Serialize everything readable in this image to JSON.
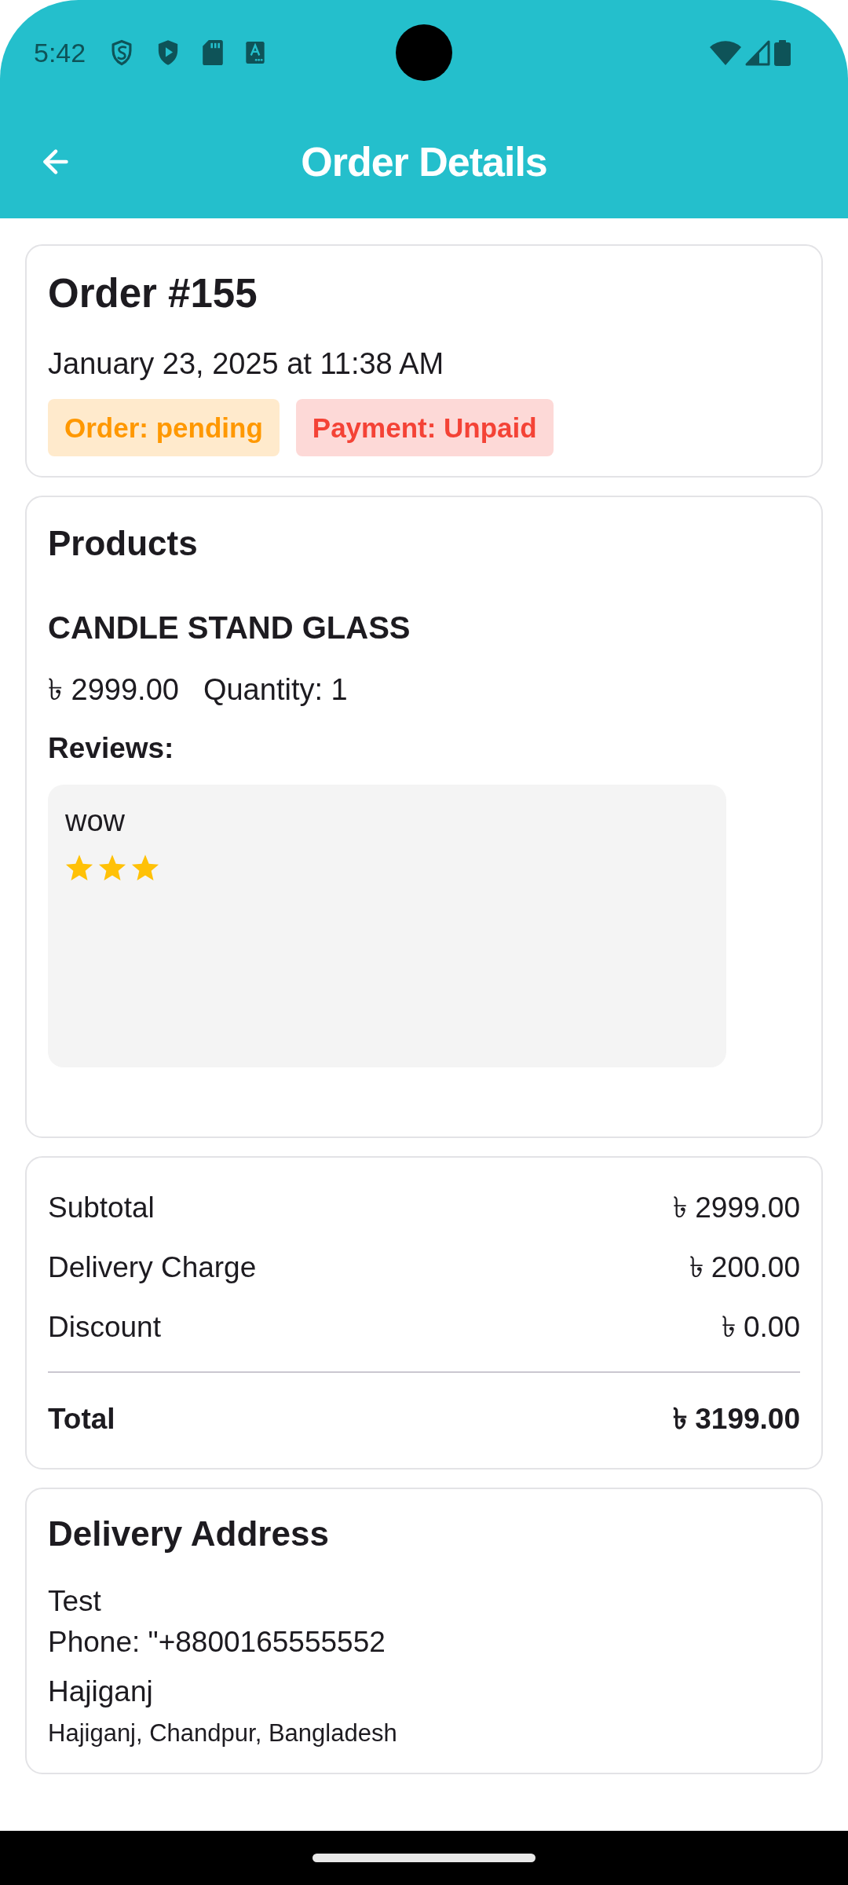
{
  "status_bar": {
    "time": "5:42"
  },
  "app_bar": {
    "title": "Order Details"
  },
  "order": {
    "title": "Order #155",
    "date": "January 23, 2025 at 11:38 AM",
    "badges": [
      {
        "label": "Order: pending",
        "color": "#ff9800"
      },
      {
        "label": "Payment: Unpaid",
        "color": "#f44336"
      }
    ]
  },
  "products": {
    "heading": "Products",
    "items": [
      {
        "name": "CANDLE STAND GLASS",
        "price": "৳ 2999.00",
        "quantity": "Quantity: 1",
        "reviews_label": "Reviews:",
        "reviews": [
          {
            "comment": "wow",
            "stars": 3
          }
        ]
      }
    ]
  },
  "summary": {
    "rows": [
      {
        "label": "Subtotal",
        "value": "৳ 2999.00"
      },
      {
        "label": "Delivery Charge",
        "value": "৳ 200.00"
      },
      {
        "label": "Discount",
        "value": "৳ 0.00"
      }
    ],
    "total": {
      "label": "Total",
      "value": "৳ 3199.00"
    }
  },
  "delivery_address": {
    "heading": "Delivery Address",
    "name": "Test",
    "phone": "Phone: \"+8800165555552",
    "area": "Hajiganj",
    "full_address": "Hajiganj, Chandpur, Bangladesh"
  }
}
